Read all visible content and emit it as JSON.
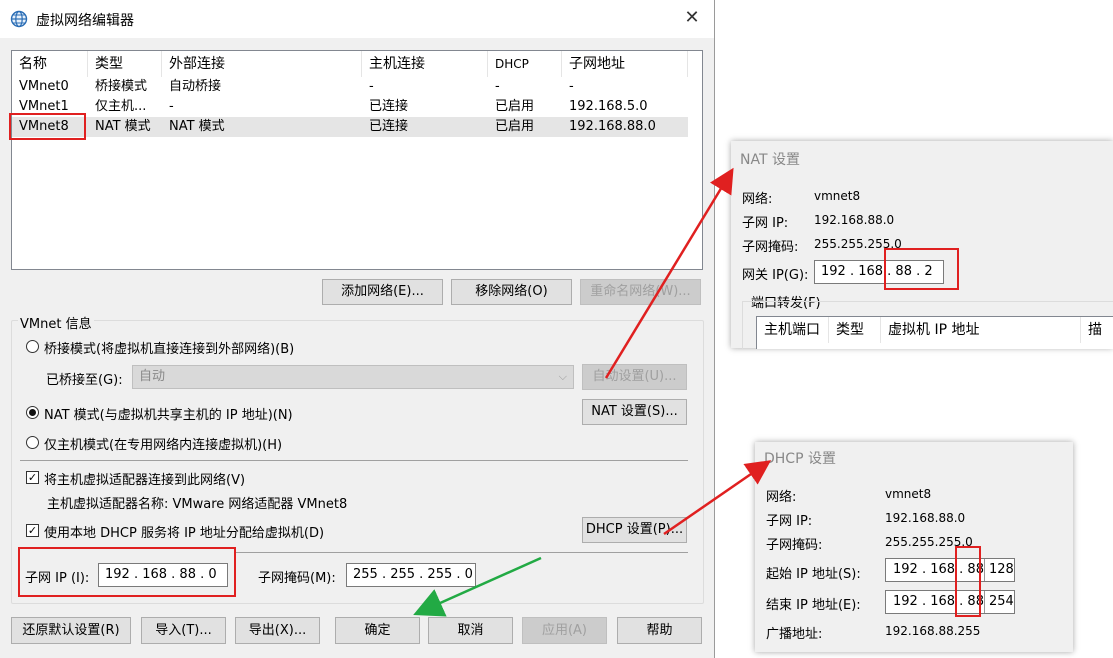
{
  "window": {
    "title": "虚拟网络编辑器"
  },
  "network_table": {
    "columns": [
      "名称",
      "类型",
      "外部连接",
      "主机连接",
      "DHCP",
      "子网地址"
    ],
    "rows": [
      {
        "name": "VMnet0",
        "type": "桥接模式",
        "external": "自动桥接",
        "host": "-",
        "dhcp": "-",
        "subnet": "-"
      },
      {
        "name": "VMnet1",
        "type": "仅主机...",
        "external": "-",
        "host": "已连接",
        "dhcp": "已启用",
        "subnet": "192.168.5.0"
      },
      {
        "name": "VMnet8",
        "type": "NAT 模式",
        "external": "NAT 模式",
        "host": "已连接",
        "dhcp": "已启用",
        "subnet": "192.168.88.0"
      }
    ],
    "selected_row": "VMnet8"
  },
  "table_buttons": {
    "add": "添加网络(E)...",
    "remove": "移除网络(O)",
    "rename": "重命名网络(W)..."
  },
  "vmnet_info": {
    "group_label": "VMnet 信息",
    "bridge_mode": "桥接模式(将虚拟机直接连接到外部网络)(B)",
    "bridged_to_label": "已桥接至(G):",
    "bridged_to_value": "自动",
    "auto_settings": "自动设置(U)...",
    "nat_mode": "NAT 模式(与虚拟机共享主机的 IP 地址)(N)",
    "nat_settings": "NAT 设置(S)...",
    "host_only": "仅主机模式(在专用网络内连接虚拟机)(H)",
    "connect_adapter": "将主机虚拟适配器连接到此网络(V)",
    "adapter_name": "主机虚拟适配器名称: VMware 网络适配器 VMnet8",
    "use_dhcp": "使用本地 DHCP 服务将 IP 地址分配给虚拟机(D)",
    "dhcp_settings": "DHCP 设置(P)...",
    "subnet_ip_label": "子网 IP (I):",
    "subnet_ip_value": "192 . 168 . 88 . 0",
    "subnet_mask_label": "子网掩码(M):",
    "subnet_mask_value": "255 . 255 . 255 . 0"
  },
  "bottom_buttons": {
    "restore": "还原默认设置(R)",
    "import": "导入(T)...",
    "export": "导出(X)...",
    "ok": "确定",
    "cancel": "取消",
    "apply": "应用(A)",
    "help": "帮助"
  },
  "nat_panel": {
    "title": "NAT 设置",
    "network_label": "网络:",
    "network_value": "vmnet8",
    "subnet_ip_label": "子网 IP:",
    "subnet_ip_value": "192.168.88.0",
    "subnet_mask_label": "子网掩码:",
    "subnet_mask_value": "255.255.255.0",
    "gateway_label": "网关 IP(G):",
    "gateway_value": "192 . 168 . 88 . 2",
    "port_forward_label": "端口转发(F)",
    "pf_columns": [
      "主机端口",
      "类型",
      "虚拟机 IP 地址",
      "描述"
    ]
  },
  "dhcp_panel": {
    "title": "DHCP 设置",
    "network_label": "网络:",
    "network_value": "vmnet8",
    "subnet_ip_label": "子网 IP:",
    "subnet_ip_value": "192.168.88.0",
    "subnet_mask_label": "子网掩码:",
    "subnet_mask_value": "255.255.255.0",
    "start_label": "起始 IP 地址(S):",
    "start_prefix": "192 . 168 . 88",
    "start_last": "128",
    "end_label": "结束 IP 地址(E):",
    "end_prefix": "192 . 168 . 88",
    "end_last": "254",
    "broadcast_label": "广播地址:",
    "broadcast_value": "192.168.88.255"
  },
  "colors": {
    "highlight_red": "#e02020",
    "arrow_green": "#22aa44"
  }
}
